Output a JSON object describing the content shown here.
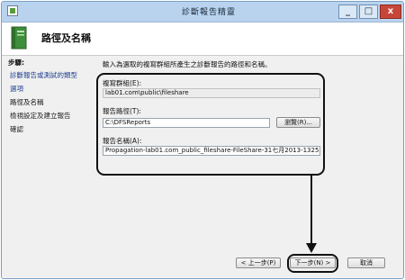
{
  "window": {
    "title": "診斷報告精靈",
    "minimize": "_",
    "maximize": "□",
    "close": "x"
  },
  "header": {
    "title": "路徑及名稱"
  },
  "sidebar": {
    "heading": "步驟:",
    "items": [
      {
        "label": "診斷報告或測試的類型"
      },
      {
        "label": "選項"
      },
      {
        "label": "路徑及名稱"
      },
      {
        "label": "檢視設定及建立報告"
      },
      {
        "label": "確認"
      }
    ]
  },
  "main": {
    "instruction": "輸入為選取的複寫群組所產生之診斷報告的路徑和名稱。",
    "replication_group_label": "複寫群組(E):",
    "replication_group_value": "lab01.com\\public\\fileshare",
    "report_path_label": "報告路徑(T):",
    "report_path_value": "C:\\DFSReports",
    "browse_label": "瀏覽(R)...",
    "report_name_label": "報告名稱(A):",
    "report_name_value": "Propagation-lab01.com_public_fileshare-FileShare-31七月2013-1325"
  },
  "footer": {
    "back_label": "< 上一步(P)",
    "next_label": "下一步(N) >",
    "cancel_label": "取消"
  },
  "colors": {
    "titlebar": "#b9d3ee",
    "link": "#1f3f8f",
    "close_button": "#c7463a"
  }
}
